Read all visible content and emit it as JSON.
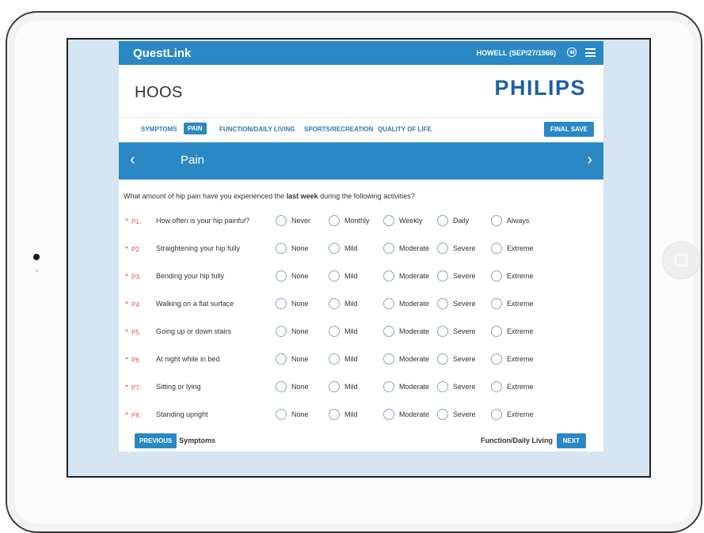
{
  "app": {
    "brand": "QuestLink",
    "patient": "HOWELL (SEP/27/1966)",
    "form_title": "HOOS",
    "logo": "PHILIPS"
  },
  "tabs": [
    "SYMPTOMS",
    "PAIN",
    "FUNCTION/DAILY LIVING",
    "SPORTS/RECREATION",
    "QUALITY OF LIFE"
  ],
  "final_save": "FINAL SAVE",
  "section": {
    "prev": "‹",
    "title": "Pain",
    "next": "›"
  },
  "instruction": {
    "pre": "What amount of hip pain have you experienced the ",
    "bold": "last week",
    "post": " during the following activities?"
  },
  "questions": [
    {
      "num": "P1.",
      "text": "How often is your hip painful?",
      "options": [
        "Never",
        "Monthly",
        "Weekly",
        "Daily",
        "Always"
      ]
    },
    {
      "num": "P2.",
      "text": "Straightening your hip fully",
      "options": [
        "None",
        "Mild",
        "Moderate",
        "Severe",
        "Extreme"
      ]
    },
    {
      "num": "P3.",
      "text": "Bending your hip fully",
      "options": [
        "None",
        "Mild",
        "Moderate",
        "Severe",
        "Extreme"
      ]
    },
    {
      "num": "P4.",
      "text": "Walking on a flat surface",
      "options": [
        "None",
        "Mild",
        "Moderate",
        "Severe",
        "Extreme"
      ]
    },
    {
      "num": "P5.",
      "text": "Going up or down stairs",
      "options": [
        "None",
        "Mild",
        "Moderate",
        "Severe",
        "Extreme"
      ]
    },
    {
      "num": "P6.",
      "text": "At night while in bed",
      "options": [
        "None",
        "Mild",
        "Moderate",
        "Severe",
        "Extreme"
      ]
    },
    {
      "num": "P7.",
      "text": "Sitting or lying",
      "options": [
        "None",
        "Mild",
        "Moderate",
        "Severe",
        "Extreme"
      ]
    },
    {
      "num": "P8.",
      "text": "Standing upright",
      "options": [
        "None",
        "Mild",
        "Moderate",
        "Severe",
        "Extreme"
      ]
    }
  ],
  "required_marker": "*",
  "footer": {
    "prev_button": "PREVIOUS",
    "prev_label": "Symptoms",
    "next_label": "Function/Daily Living",
    "next_button": "NEXT"
  },
  "colors": {
    "accent": "#2a88c4",
    "logo": "#1b5fa8",
    "required": "#e05050"
  }
}
